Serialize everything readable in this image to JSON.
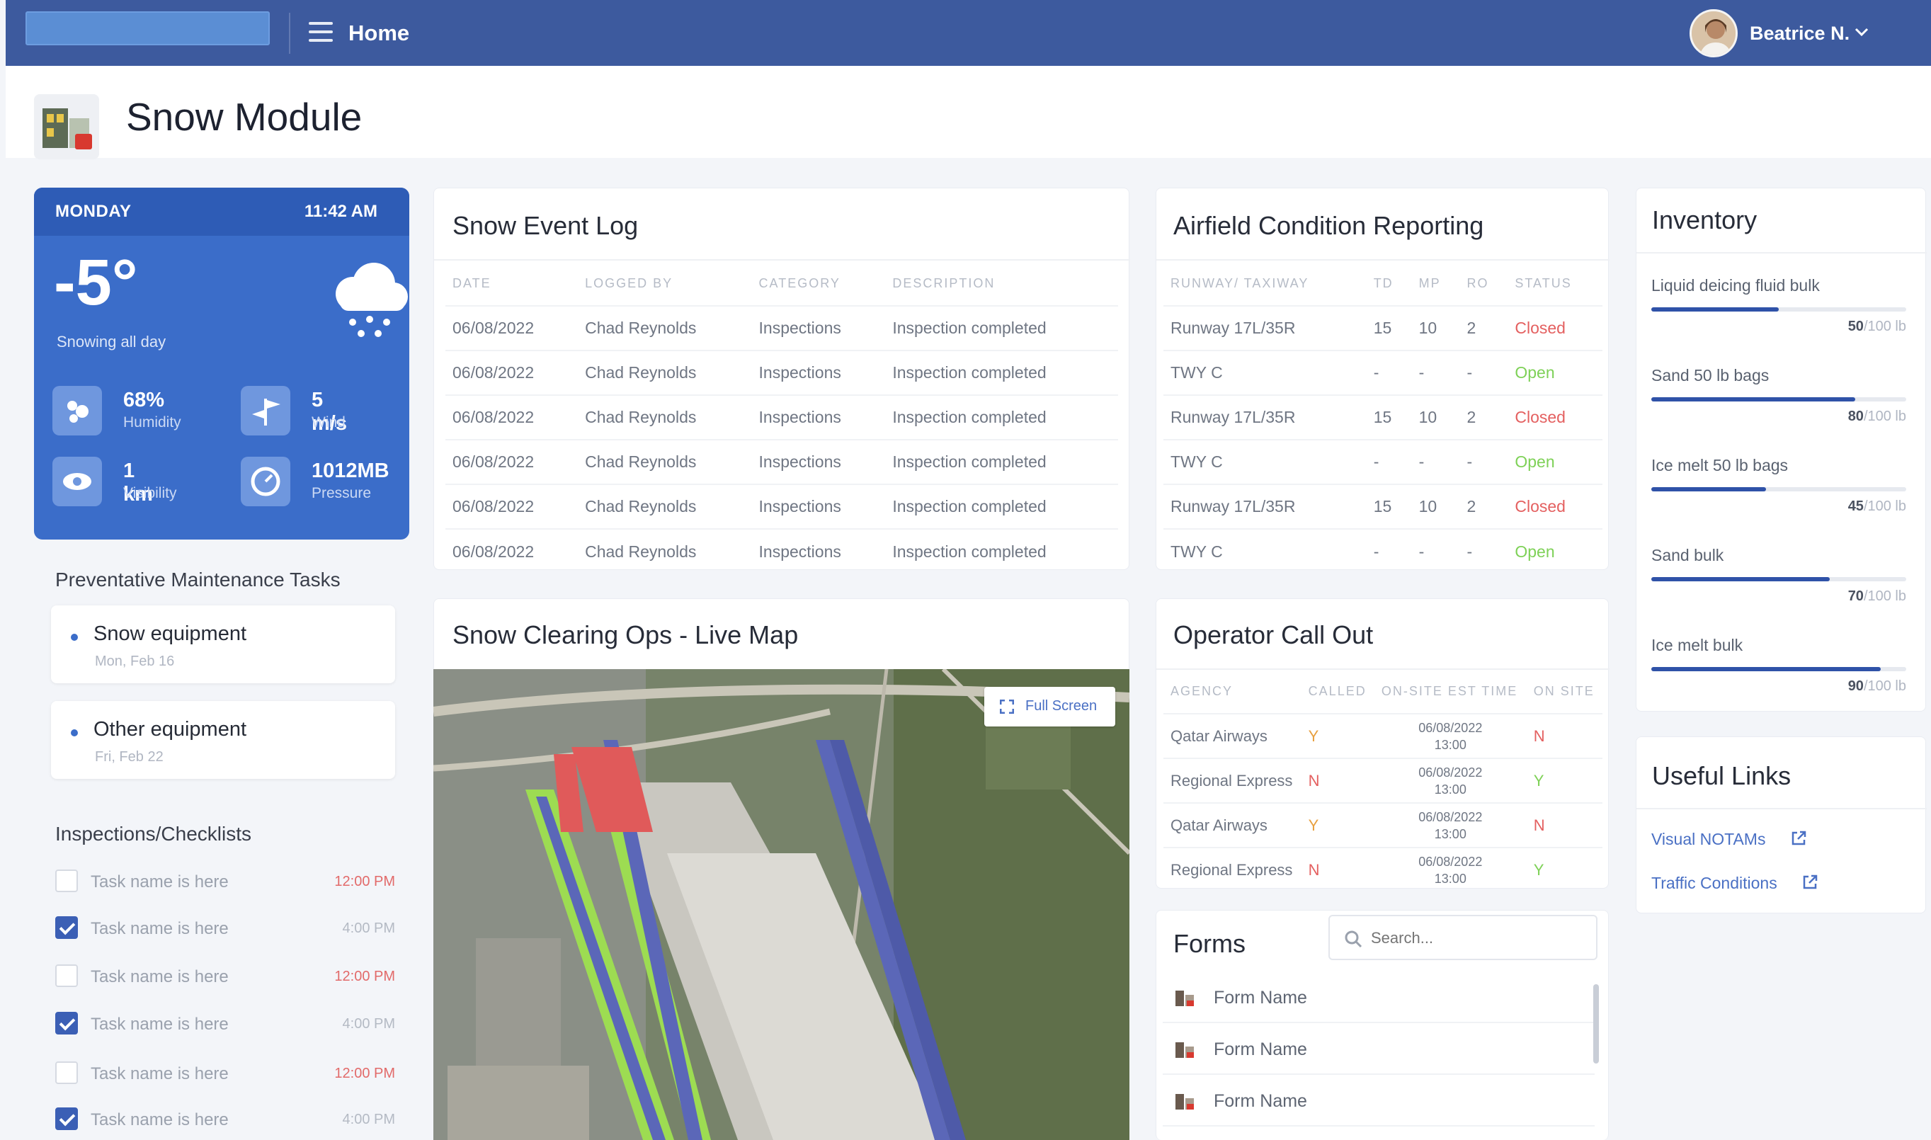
{
  "topbar": {
    "home_label": "Home",
    "user_name": "Beatrice N."
  },
  "page": {
    "title": "Snow Module"
  },
  "weather": {
    "day": "MONDAY",
    "time": "11:42 AM",
    "temperature": "-5°",
    "condition": "Snowing all day",
    "stats": [
      {
        "value": "68%",
        "label": "Humidity",
        "icon": "humidity-icon"
      },
      {
        "value": "5 m/s",
        "label": "Wind",
        "icon": "wind-icon"
      },
      {
        "value": "1 km",
        "label": "Visibility",
        "icon": "visibility-icon"
      },
      {
        "value": "1012MB",
        "label": "Pressure",
        "icon": "pressure-icon"
      }
    ]
  },
  "maintenance": {
    "title": "Preventative Maintenance Tasks",
    "items": [
      {
        "name": "Snow equipment",
        "date": "Mon, Feb 16"
      },
      {
        "name": "Other equipment",
        "date": "Fri, Feb 22"
      }
    ]
  },
  "inspections": {
    "title": "Inspections/Checklists",
    "items": [
      {
        "task": "Task name is here",
        "time": "12:00 PM",
        "checked": false
      },
      {
        "task": "Task name is here",
        "time": "4:00 PM",
        "checked": true
      },
      {
        "task": "Task name is here",
        "time": "12:00 PM",
        "checked": false
      },
      {
        "task": "Task name is here",
        "time": "4:00 PM",
        "checked": true
      },
      {
        "task": "Task name is here",
        "time": "12:00 PM",
        "checked": false
      },
      {
        "task": "Task name is here",
        "time": "4:00 PM",
        "checked": true
      }
    ]
  },
  "event_log": {
    "title": "Snow Event Log",
    "columns": [
      "DATE",
      "LOGGED BY",
      "CATEGORY",
      "DESCRIPTION"
    ],
    "rows": [
      [
        "06/08/2022",
        "Chad Reynolds",
        "Inspections",
        "Inspection completed"
      ],
      [
        "06/08/2022",
        "Chad Reynolds",
        "Inspections",
        "Inspection completed"
      ],
      [
        "06/08/2022",
        "Chad Reynolds",
        "Inspections",
        "Inspection completed"
      ],
      [
        "06/08/2022",
        "Chad Reynolds",
        "Inspections",
        "Inspection completed"
      ],
      [
        "06/08/2022",
        "Chad Reynolds",
        "Inspections",
        "Inspection completed"
      ],
      [
        "06/08/2022",
        "Chad Reynolds",
        "Inspections",
        "Inspection completed"
      ]
    ]
  },
  "airfield": {
    "title": "Airfield Condition Reporting",
    "columns": [
      "RUNWAY/ TAXIWAY",
      "TD",
      "MP",
      "RO",
      "STATUS"
    ],
    "rows": [
      [
        "Runway 17L/35R",
        "15",
        "10",
        "2",
        "Closed"
      ],
      [
        "TWY C",
        "-",
        "-",
        "-",
        "Open"
      ],
      [
        "Runway 17L/35R",
        "15",
        "10",
        "2",
        "Closed"
      ],
      [
        "TWY C",
        "-",
        "-",
        "-",
        "Open"
      ],
      [
        "Runway 17L/35R",
        "15",
        "10",
        "2",
        "Closed"
      ],
      [
        "TWY C",
        "-",
        "-",
        "-",
        "Open"
      ]
    ]
  },
  "map": {
    "title": "Snow Clearing Ops - Live Map",
    "fullscreen_label": "Full Screen"
  },
  "callout": {
    "title": "Operator Call Out",
    "columns": [
      "AGENCY",
      "CALLED",
      "ON-SITE EST TIME",
      "ON SITE"
    ],
    "rows": [
      [
        "Qatar Airways",
        "Y",
        "06/08/2022",
        "13:00",
        "N"
      ],
      [
        "Regional Express",
        "N",
        "06/08/2022",
        "13:00",
        "Y"
      ],
      [
        "Qatar Airways",
        "Y",
        "06/08/2022",
        "13:00",
        "N"
      ],
      [
        "Regional Express",
        "N",
        "06/08/2022",
        "13:00",
        "Y"
      ]
    ]
  },
  "forms": {
    "title": "Forms",
    "search_placeholder": "Search...",
    "items": [
      "Form Name",
      "Form Name",
      "Form Name"
    ]
  },
  "inventory": {
    "title": "Inventory",
    "items": [
      {
        "name": "Liquid deicing fluid bulk",
        "amount": "50",
        "total": "/100 lb",
        "level": 0.5
      },
      {
        "name": "Sand 50 lb bags",
        "amount": "80",
        "total": "/100 lb",
        "level": 0.8
      },
      {
        "name": "Ice melt 50 lb bags",
        "amount": "45",
        "total": "/100 lb",
        "level": 0.45
      },
      {
        "name": "Sand bulk",
        "amount": "70",
        "total": "/100 lb",
        "level": 0.7
      },
      {
        "name": "Ice melt bulk",
        "amount": "90",
        "total": "/100 lb",
        "level": 0.9
      }
    ]
  },
  "links": {
    "title": "Useful Links",
    "items": [
      "Visual NOTAMs",
      "Traffic Conditions"
    ]
  },
  "colors": {
    "topbar": "#3d5a9e",
    "weather_card": "#3b6dc9",
    "accent": "#2f52a8",
    "closed": "#e46060",
    "open": "#7ed157"
  }
}
